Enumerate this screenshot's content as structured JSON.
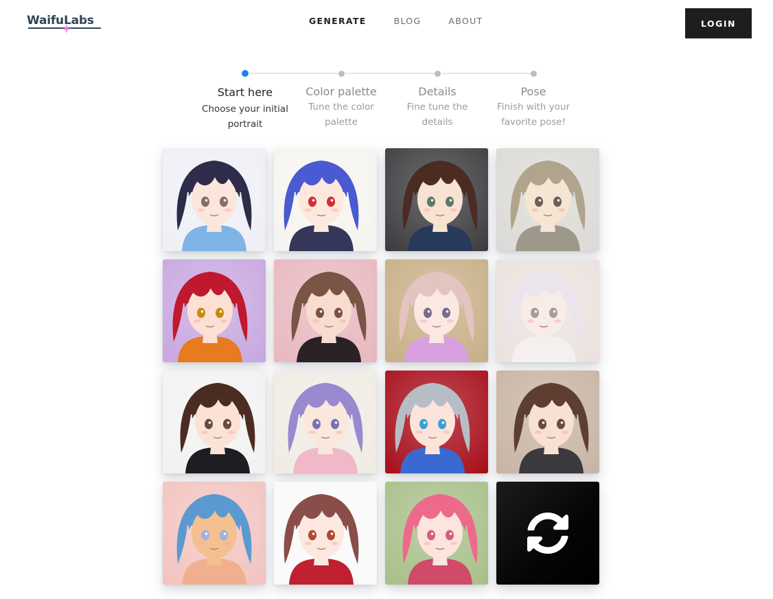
{
  "header": {
    "logo_text": "WaifuLabs",
    "logo_accent_color": "#f07fe0",
    "logo_color": "#2e4555",
    "nav": [
      {
        "label": "GENERATE",
        "active": true
      },
      {
        "label": "BLOG",
        "active": false
      },
      {
        "label": "ABOUT",
        "active": false
      }
    ],
    "login_label": "LOGIN"
  },
  "stepper": {
    "active_color": "#1a86f0",
    "steps": [
      {
        "title": "Start here",
        "desc_line1": "Choose your initial",
        "desc_line2": "portrait",
        "active": true
      },
      {
        "title": "Color palette",
        "desc_line1": "Tune the color",
        "desc_line2": "palette",
        "active": false
      },
      {
        "title": "Details",
        "desc_line1": "Fine tune the",
        "desc_line2": "details",
        "active": false
      },
      {
        "title": "Pose",
        "desc_line1": "Finish with your",
        "desc_line2": "favorite pose!",
        "active": false
      }
    ]
  },
  "portraits": [
    {
      "label": "portrait-1",
      "bg": "#eef0f6",
      "hair": "#2e2c4a",
      "skin": "#fbe6dc",
      "cloth": "#7fb4e6",
      "eyes": "#8a6a6a"
    },
    {
      "label": "portrait-2",
      "bg": "#f6f4f0",
      "hair": "#4a5ad0",
      "skin": "#fde8de",
      "cloth": "#34365a",
      "eyes": "#d02f3a"
    },
    {
      "label": "portrait-3",
      "bg": "#3d3d40",
      "hair": "#4a2c22",
      "skin": "#f8e2d2",
      "cloth": "#283a5a",
      "eyes": "#5c7a6a"
    },
    {
      "label": "portrait-4",
      "bg": "#dcdad6",
      "hair": "#b0a48c",
      "skin": "#f4e6d2",
      "cloth": "#9e988a",
      "eyes": "#6a6056"
    },
    {
      "label": "portrait-5",
      "bg": "#c8a8e0",
      "hair": "#c0182c",
      "skin": "#fde0d4",
      "cloth": "#e87a20",
      "eyes": "#c88a10"
    },
    {
      "label": "portrait-6",
      "bg": "#e8b8c0",
      "hair": "#7a5444",
      "skin": "#f8dcd0",
      "cloth": "#2a2224",
      "eyes": "#7a5040"
    },
    {
      "label": "portrait-7",
      "bg": "#c8b088",
      "hair": "#e4c4c0",
      "skin": "#fbe8e2",
      "cloth": "#d8a0e0",
      "eyes": "#7a6a8a"
    },
    {
      "label": "portrait-8",
      "bg": "#ebe2de",
      "hair": "#ece4ec",
      "skin": "#f8ece6",
      "cloth": "#f4f0f0",
      "eyes": "#a89aa0"
    },
    {
      "label": "portrait-9",
      "bg": "#f2f2f2",
      "hair": "#4a2c22",
      "skin": "#fbe2d6",
      "cloth": "#1e1e22",
      "eyes": "#6a4a3a"
    },
    {
      "label": "portrait-10",
      "bg": "#f0ece4",
      "hair": "#9a88d0",
      "skin": "#fae8dc",
      "cloth": "#f0b8c8",
      "eyes": "#7a70b8"
    },
    {
      "label": "portrait-11",
      "bg": "#a8101c",
      "hair": "#b8bcc4",
      "skin": "#fbe4da",
      "cloth": "#3a6ad0",
      "eyes": "#3aa0d8"
    },
    {
      "label": "portrait-12",
      "bg": "#c8b4a4",
      "hair": "#5e3e30",
      "skin": "#f8e0d2",
      "cloth": "#3a3a3c",
      "eyes": "#6a4a3a"
    },
    {
      "label": "portrait-13",
      "bg": "#f2c4c0",
      "hair": "#5a9ad0",
      "skin": "#f4c090",
      "cloth": "#f0b090",
      "eyes": "#a0b0e0"
    },
    {
      "label": "portrait-14",
      "bg": "#fafafa",
      "hair": "#8a4e4a",
      "skin": "#fde8e0",
      "cloth": "#c02030",
      "eyes": "#b04a30"
    },
    {
      "label": "portrait-15",
      "bg": "#a8c08a",
      "hair": "#ee6a8a",
      "skin": "#fde4dc",
      "cloth": "#d04a6a",
      "eyes": "#d06080"
    }
  ],
  "refresh": {
    "label": "refresh-portraits"
  }
}
